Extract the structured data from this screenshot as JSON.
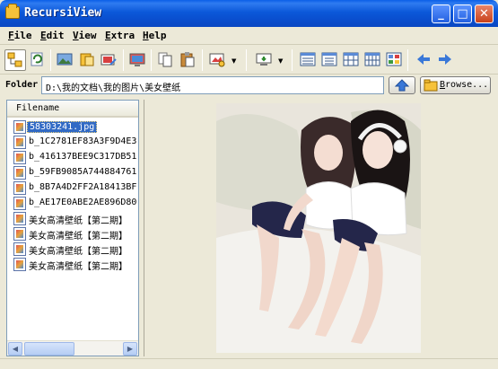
{
  "window": {
    "title": "RecursiView",
    "minimize_glyph": "_",
    "maximize_glyph": "□",
    "close_glyph": "✕"
  },
  "menu": [
    "File",
    "Edit",
    "View",
    "Extra",
    "Help"
  ],
  "toolbar": {
    "icons": [
      "tree-view-icon",
      "refresh-icon",
      "image-view-icon",
      "folder-open-icon",
      "image-edit-icon",
      "monitor-icon",
      "copy-icon",
      "paste-icon",
      "image-settings-icon",
      "screen-icon",
      "view-details-icon",
      "view-list-icon",
      "view-columns-icon",
      "view-grid-icon",
      "view-thumbnails-icon",
      "back-arrow-icon",
      "forward-arrow-icon"
    ],
    "dropdown_glyph": "▼"
  },
  "folder": {
    "label": "Folder",
    "path": "D:\\我的文档\\我的图片\\美女壁纸",
    "browse_label": "Browse..."
  },
  "file_list": {
    "header": "Filename",
    "files": [
      "58303241.jpg",
      "b_1C2781EF83A3F9D4E3",
      "b_416137BEE9C317DB51",
      "b_59FB9085A744884761",
      "b_8B7A4D2FF2A18413BF",
      "b_AE17E0ABE2AE896D80",
      "美女高清壁纸【第二期】",
      "美女高清壁纸【第二期】",
      "美女高清壁纸【第二期】",
      "美女高清壁纸【第二期】"
    ],
    "selected_index": 0
  },
  "scrollbar": {
    "left_glyph": "◀",
    "right_glyph": "▶"
  },
  "colors": {
    "titlebar": "#0a4fcf",
    "selection": "#316ac5",
    "arrow_blue": "#3a78d8"
  }
}
